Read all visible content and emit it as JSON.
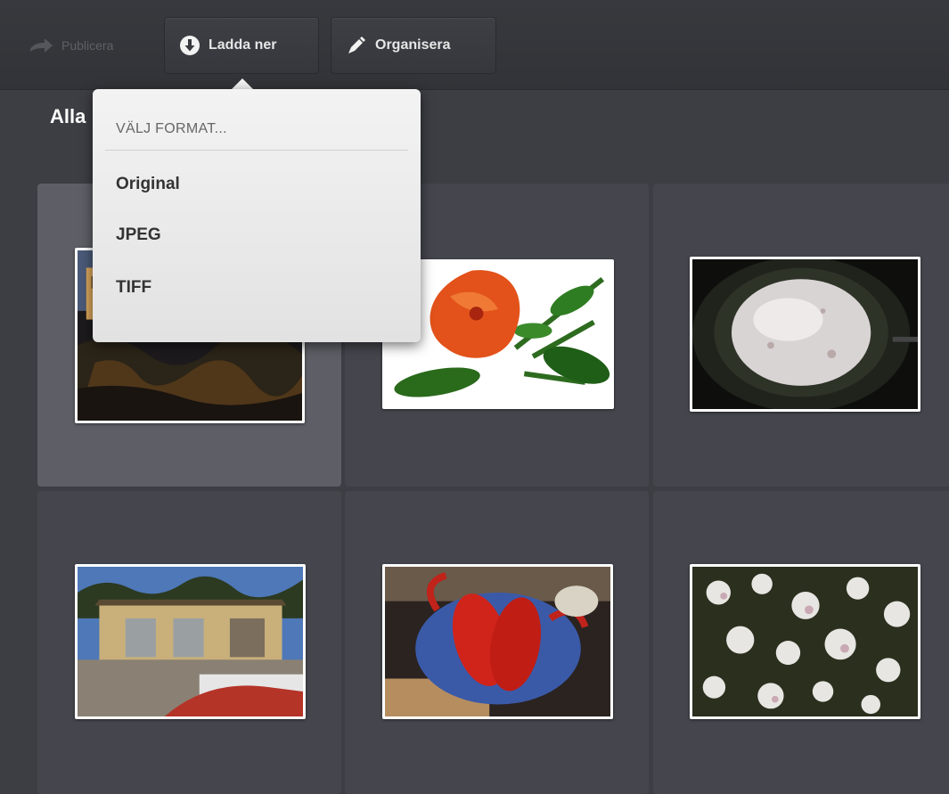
{
  "toolbar": {
    "publish": {
      "label": "Publicera",
      "icon": "arrow-right-icon",
      "disabled": true
    },
    "download": {
      "label": "Ladda ner",
      "icon": "download-circle-icon"
    },
    "organize": {
      "label": "Organisera",
      "icon": "pen-icon"
    }
  },
  "section_title": "Alla",
  "format_menu": {
    "heading": "VÄLJ FORMAT...",
    "items": [
      "Original",
      "JPEG",
      "TIFF"
    ]
  },
  "photos": [
    {
      "subject": "night building",
      "selected": true
    },
    {
      "subject": "orange hibiscus"
    },
    {
      "subject": "pancake in pan"
    },
    {
      "subject": "garage building"
    },
    {
      "subject": "lobsters on plate"
    },
    {
      "subject": "white blossoms"
    }
  ],
  "colors": {
    "background": "#3d3e44",
    "tile": "#45464d",
    "tile_selected": "#5e5f66",
    "menu": "#ececec"
  }
}
